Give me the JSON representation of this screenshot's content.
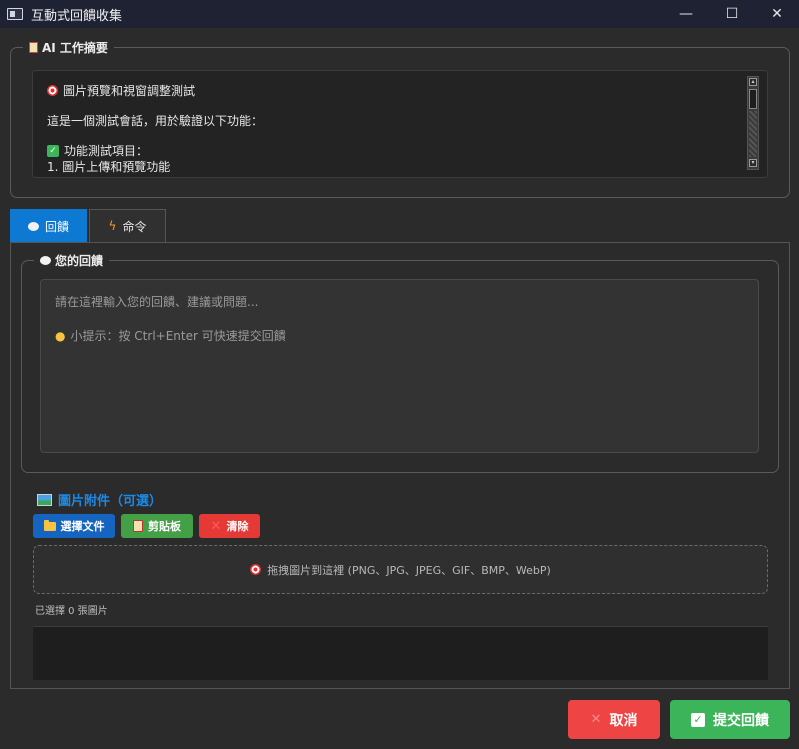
{
  "window": {
    "title": "互動式回饋收集",
    "minimize_glyph": "—",
    "maximize_glyph": "☐",
    "close_glyph": "✕"
  },
  "summary": {
    "group_title": "AI 工作摘要",
    "lines": [
      "圖片預覽和視窗調整測試",
      "這是一個測試會話，用於驗證以下功能：",
      "功能測試項目：",
      "1. 圖片上傳和預覽功能"
    ],
    "scroll_up": "▴",
    "scroll_down": "▾"
  },
  "tabs": [
    {
      "label": "回饋",
      "icon": "speech-bubble-icon"
    },
    {
      "label": "命令",
      "icon": "lightning-icon"
    }
  ],
  "feedback": {
    "group_title": "您的回饋",
    "placeholder": "請在這裡輸入您的回饋、建議或問題...",
    "hint": "小提示：按 Ctrl+Enter 可快速提交回饋"
  },
  "images": {
    "title": "圖片附件（可選）",
    "buttons": {
      "select": "選擇文件",
      "clipboard": "剪貼板",
      "clear": "清除"
    },
    "button_colors": {
      "select": "#1565c0",
      "clipboard": "#43a047",
      "clear": "#e53935"
    },
    "dropzone_text": "拖拽圖片到這裡 (PNG、JPG、JPEG、GIF、BMP、WebP)",
    "count_text": "已選擇 0 張圖片"
  },
  "actions": {
    "cancel": "取消",
    "submit": "提交回饋"
  },
  "colors": {
    "accent": "#0d79d2",
    "cancel": "#ef4444",
    "submit": "#3cb55a",
    "image_title": "#1e88e5"
  }
}
